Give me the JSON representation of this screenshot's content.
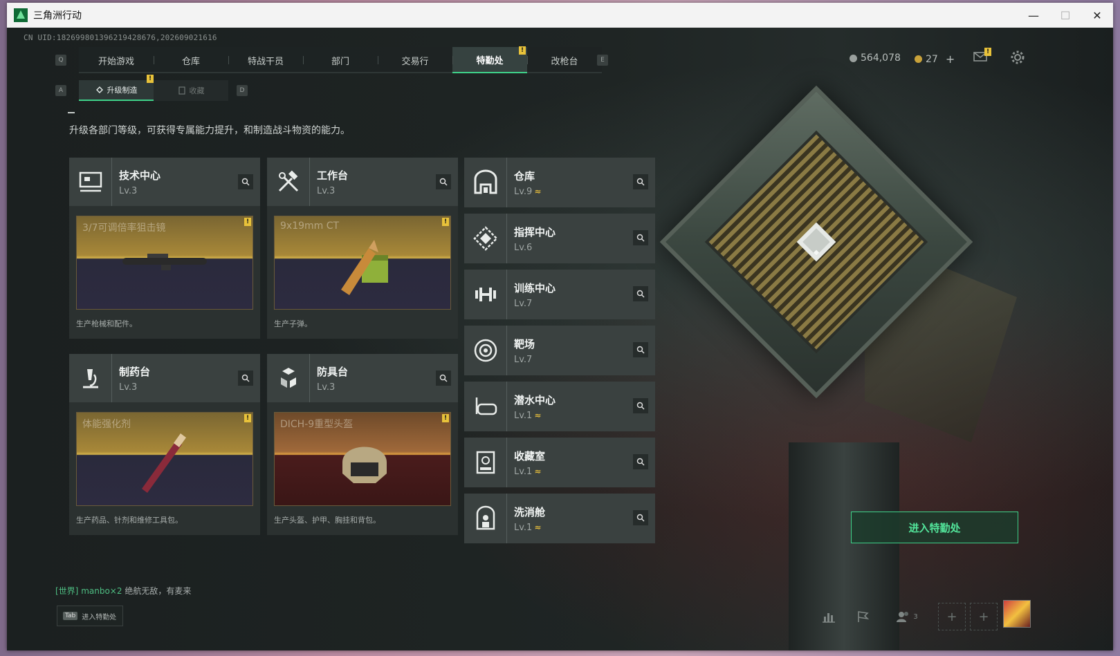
{
  "window": {
    "title": "三角洲行动",
    "controls": {
      "minimize": "—",
      "maximize": "☐",
      "close": "✕"
    }
  },
  "uid_text": "CN UID:18269980139621942867​6,20260902161​6",
  "hotkeys": {
    "tab_left": "Q",
    "tab_right": "E",
    "sub_left": "A",
    "sub_right": "D"
  },
  "nav": {
    "tabs": [
      {
        "label": "开始游戏"
      },
      {
        "label": "仓库"
      },
      {
        "label": "特战干员"
      },
      {
        "label": "部门"
      },
      {
        "label": "交易行"
      },
      {
        "label": "特勤处"
      },
      {
        "label": "改枪台"
      }
    ],
    "active_index": 5,
    "active_badge": "!"
  },
  "currency": {
    "coins": "564,078",
    "tickets": "27",
    "add": "+",
    "mail_badge": "!"
  },
  "subtabs": [
    {
      "label": "升级制造",
      "badge": "!"
    },
    {
      "label": "收藏"
    }
  ],
  "description": "升级各部门等级，可获得专属能力提升，和制造战斗物资的能力。",
  "production_cards": [
    {
      "name": "技术中心",
      "level": "Lv.3",
      "item": "3/7可调倍率狙击镜",
      "desc": "生产枪械和配件。",
      "badge": "!",
      "theme": "purple"
    },
    {
      "name": "工作台",
      "level": "Lv.3",
      "item": "9x19mm CT",
      "desc": "生产子弹。",
      "badge": "!",
      "theme": "purple"
    },
    {
      "name": "制药台",
      "level": "Lv.3",
      "item": "体能强化剂",
      "desc": "生产药品、针剂和维修工具包。",
      "badge": "!",
      "theme": "purple"
    },
    {
      "name": "防具台",
      "level": "Lv.3",
      "item": "DICH-9重型头盔",
      "desc": "生产头盔、护甲、胸挂和背包。",
      "badge": "!",
      "theme": "red"
    }
  ],
  "side_departments": [
    {
      "name": "仓库",
      "level": "Lv.9",
      "upgradable": true
    },
    {
      "name": "指挥中心",
      "level": "Lv.6",
      "upgradable": false
    },
    {
      "name": "训练中心",
      "level": "Lv.7",
      "upgradable": false
    },
    {
      "name": "靶场",
      "level": "Lv.7",
      "upgradable": false
    },
    {
      "name": "潜水中心",
      "level": "Lv.1",
      "upgradable": true
    },
    {
      "name": "收藏室",
      "level": "Lv.1",
      "upgradable": true
    },
    {
      "name": "洗消舱",
      "level": "Lv.1",
      "upgradable": true
    }
  ],
  "upgrade_glyph": "≈",
  "enter_button": "进入特勤处",
  "chat": {
    "channel": "[世界]",
    "user": "manbo×2",
    "message": "绝航无敌，有麦来"
  },
  "tab_hint": {
    "key": "Tab",
    "label": "进入特勤处"
  },
  "bottom_bar": {
    "friends_count": "3",
    "plus": "+"
  },
  "colors": {
    "accent": "#3fd38a",
    "badge": "#e8c23a",
    "upgrade": "#e0b93c"
  }
}
